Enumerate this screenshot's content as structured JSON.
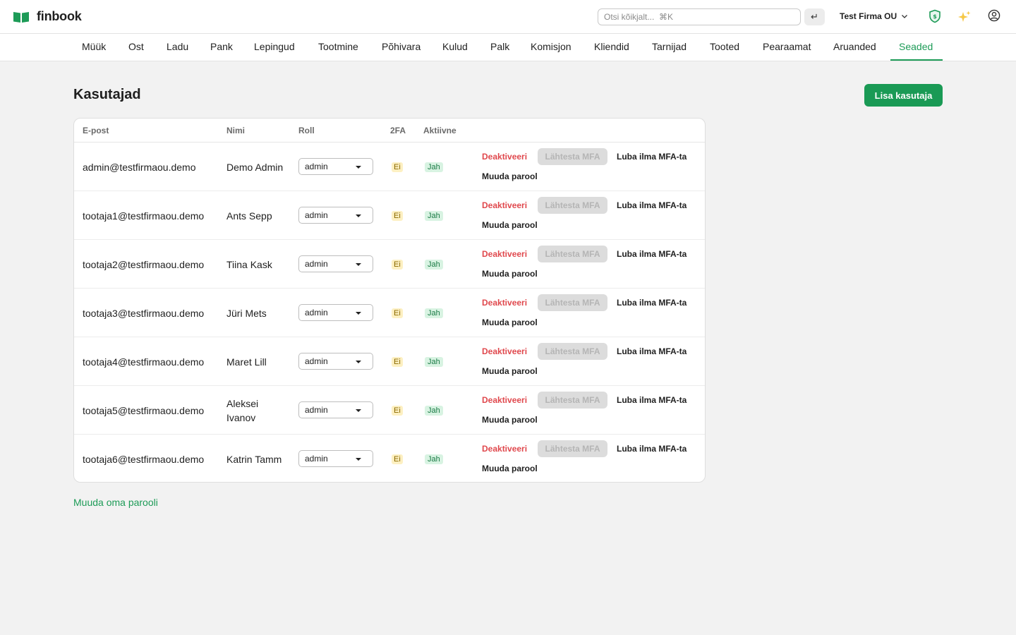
{
  "app": {
    "name": "finbook",
    "brand_color": "#1d9b57"
  },
  "header": {
    "search_placeholder": "Otsi kõikjalt...  ⌘K",
    "enter_icon": "↵",
    "company": "Test Firma OU",
    "icons": [
      "shield-icon",
      "sparkle-icon",
      "user-circle-icon"
    ]
  },
  "nav": {
    "items": [
      {
        "label": "Müük",
        "active": false
      },
      {
        "label": "Ost",
        "active": false
      },
      {
        "label": "Ladu",
        "active": false
      },
      {
        "label": "Pank",
        "active": false
      },
      {
        "label": "Lepingud",
        "active": false
      },
      {
        "label": "Tootmine",
        "active": false
      },
      {
        "label": "Põhivara",
        "active": false
      },
      {
        "label": "Kulud",
        "active": false
      },
      {
        "label": "Palk",
        "active": false
      },
      {
        "label": "Komisjon",
        "active": false
      },
      {
        "label": "Kliendid",
        "active": false
      },
      {
        "label": "Tarnijad",
        "active": false
      },
      {
        "label": "Tooted",
        "active": false
      },
      {
        "label": "Pearaamat",
        "active": false
      },
      {
        "label": "Aruanded",
        "active": false
      },
      {
        "label": "Seaded",
        "active": true
      }
    ]
  },
  "page": {
    "title": "Kasutajad",
    "add_button": "Lisa kasutaja",
    "own_password_link": "Muuda oma parooli"
  },
  "table": {
    "headers": {
      "email": "E-post",
      "name": "Nimi",
      "role": "Roll",
      "twofa": "2FA",
      "active": "Aktiivne"
    },
    "actions": {
      "deactivate": "Deaktiveeri",
      "reset_mfa": "Lähtesta MFA",
      "allow_no_mfa": "Luba ilma MFA-ta",
      "change_password": "Muuda parool"
    },
    "rows": [
      {
        "email": "admin@testfirmaou.demo",
        "name": "Demo Admin",
        "role": "admin",
        "twofa": "Ei",
        "active": "Jah"
      },
      {
        "email": "tootaja1@testfirmaou.demo",
        "name": "Ants Sepp",
        "role": "admin",
        "twofa": "Ei",
        "active": "Jah"
      },
      {
        "email": "tootaja2@testfirmaou.demo",
        "name": "Tiina Kask",
        "role": "admin",
        "twofa": "Ei",
        "active": "Jah"
      },
      {
        "email": "tootaja3@testfirmaou.demo",
        "name": "Jüri Mets",
        "role": "admin",
        "twofa": "Ei",
        "active": "Jah"
      },
      {
        "email": "tootaja4@testfirmaou.demo",
        "name": "Maret Lill",
        "role": "admin",
        "twofa": "Ei",
        "active": "Jah"
      },
      {
        "email": "tootaja5@testfirmaou.demo",
        "name": "Aleksei Ivanov",
        "role": "admin",
        "twofa": "Ei",
        "active": "Jah"
      },
      {
        "email": "tootaja6@testfirmaou.demo",
        "name": "Katrin Tamm",
        "role": "admin",
        "twofa": "Ei",
        "active": "Jah"
      }
    ]
  }
}
